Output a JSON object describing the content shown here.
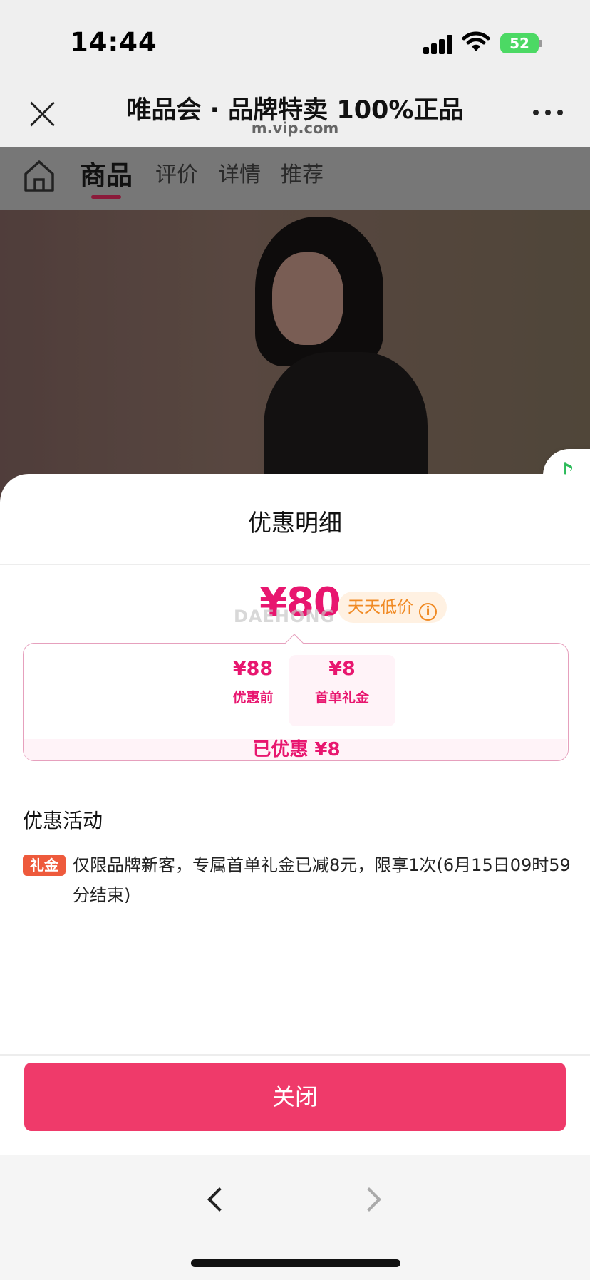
{
  "status": {
    "time": "14:44",
    "battery": "52"
  },
  "browser": {
    "title": "唯品会 · 品牌特卖 100%正品",
    "url": "m.vip.com"
  },
  "page_tabs": [
    "商品",
    "评价",
    "详情",
    "推荐"
  ],
  "sheet": {
    "title": "优惠明细",
    "price": "¥80",
    "watermark": "DAEHONG",
    "price_badge": "天天低价",
    "breakdown": {
      "before_value": "¥88",
      "before_label": "优惠前",
      "minus": "−",
      "gift_value": "¥8",
      "gift_label": "首单礼金",
      "saved": "已优惠 ¥8"
    },
    "promo_heading": "优惠活动",
    "promo_tag": "礼金",
    "promo_desc": "仅限品牌新客，专属首单礼金已减8元，限享1次(6月15日09时59分结束)",
    "close_label": "关闭"
  },
  "colors": {
    "accent": "#e8166f",
    "button": "#ef3a6a",
    "badge_text": "#f08a24",
    "tag": "#ee5a3c"
  }
}
